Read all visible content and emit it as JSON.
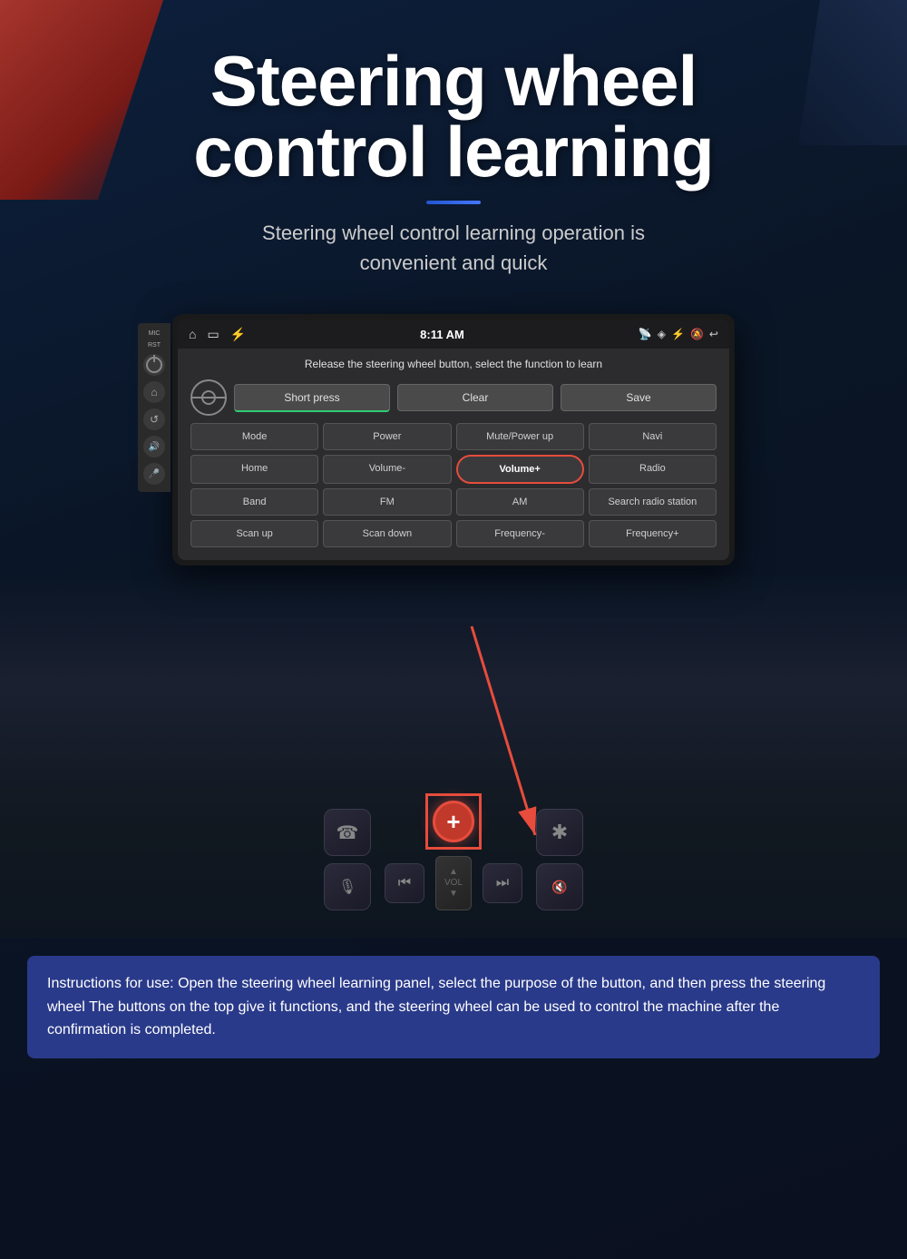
{
  "title": {
    "line1": "Steering wheel",
    "line2": "control learning",
    "subtitle": "Steering wheel control learning operation is\nconvenient and quick"
  },
  "device": {
    "side_labels": [
      "MIC",
      "RST"
    ]
  },
  "status_bar": {
    "time": "8:11 AM",
    "icons": [
      "cast",
      "location",
      "bluetooth",
      "mute",
      "back"
    ]
  },
  "panel": {
    "instruction": "Release the steering wheel button, select the function to learn",
    "buttons": {
      "short_press": "Short press",
      "clear": "Clear",
      "save": "Save"
    },
    "grid": [
      {
        "label": "Mode",
        "id": "mode"
      },
      {
        "label": "Power",
        "id": "power"
      },
      {
        "label": "Mute/Power up",
        "id": "mute-power"
      },
      {
        "label": "Navi",
        "id": "navi"
      },
      {
        "label": "Home",
        "id": "home"
      },
      {
        "label": "Volume-",
        "id": "volume-down"
      },
      {
        "label": "Volume+",
        "id": "volume-up",
        "highlighted": true
      },
      {
        "label": "Radio",
        "id": "radio"
      },
      {
        "label": "Band",
        "id": "band"
      },
      {
        "label": "FM",
        "id": "fm"
      },
      {
        "label": "AM",
        "id": "am"
      },
      {
        "label": "Search radio station",
        "id": "search-radio"
      },
      {
        "label": "Scan up",
        "id": "scan-up"
      },
      {
        "label": "Scan down",
        "id": "scan-down"
      },
      {
        "label": "Frequency-",
        "id": "freq-down"
      },
      {
        "label": "Frequency+",
        "id": "freq-up"
      }
    ]
  },
  "instructions": {
    "text": "Instructions for use: Open the steering wheel learning panel, select the purpose of the button, and then press the steering wheel The buttons on the top give it functions, and the steering wheel can be used to control the machine after the confirmation is completed."
  },
  "colors": {
    "bg": "#0a1628",
    "accent_red": "#c0392b",
    "accent_blue": "#2a3a8a",
    "title_white": "#ffffff",
    "panel_dark": "#2c2c2e",
    "btn_default": "#3a3a3c",
    "btn_highlighted_border": "#e74c3c"
  }
}
